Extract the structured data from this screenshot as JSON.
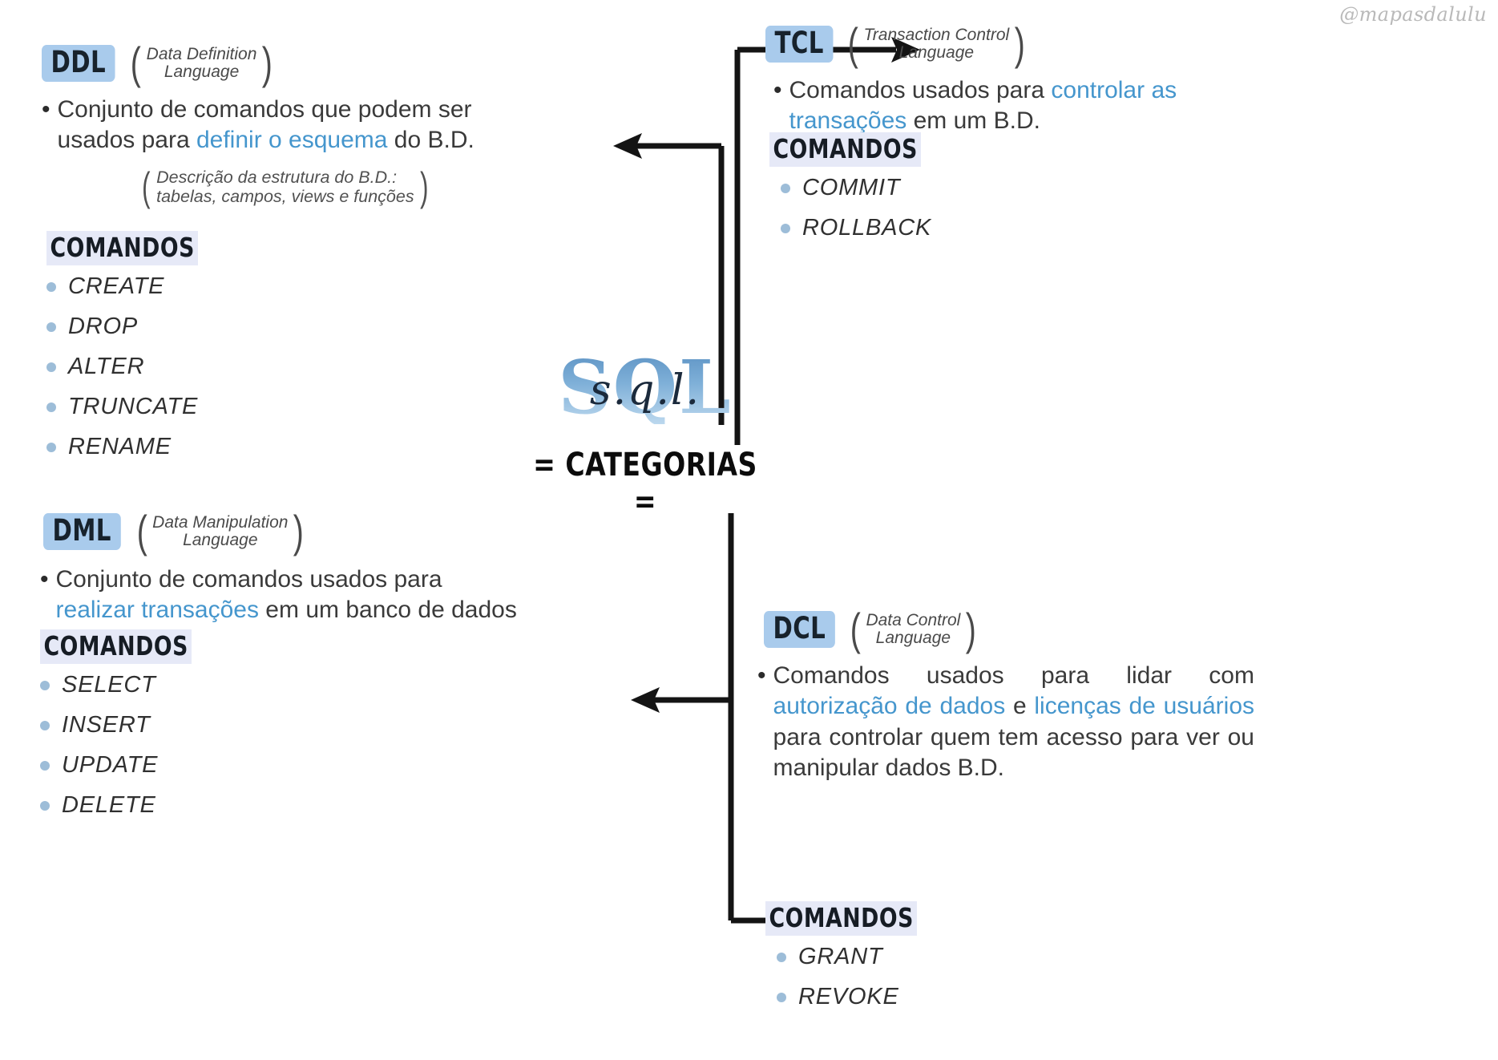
{
  "watermark": "@mapasdalulu",
  "center": {
    "logo_text": "SQL",
    "logo_script": "s.q.l.",
    "subtitle": "= CATEGORIAS ="
  },
  "categories": [
    {
      "id": "ddl",
      "abbr": "DDL",
      "expansion": "Data Definition\nLanguage",
      "description_parts": [
        {
          "text": "Conjunto de comandos que podem ser usados para ",
          "highlight": false
        },
        {
          "text": "definir o esquema",
          "highlight": true
        },
        {
          "text": " do B.D.",
          "highlight": false
        }
      ],
      "description_plain": "Conjunto de comandos que podem ser usados para definir o esquema do B.D.",
      "note": "Descrição da estrutura do B.D.:\ntabelas, campos, views e funções",
      "commands_title": "COMANDOS",
      "commands": [
        "CREATE",
        "DROP",
        "ALTER",
        "TRUNCATE",
        "RENAME"
      ]
    },
    {
      "id": "dml",
      "abbr": "DML",
      "expansion": "Data Manipulation\nLanguage",
      "description_parts": [
        {
          "text": "Conjunto de comandos usados para ",
          "highlight": false
        },
        {
          "text": "realizar transações",
          "highlight": true
        },
        {
          "text": " em um banco de dados",
          "highlight": false
        }
      ],
      "description_plain": "Conjunto de comandos usados para realizar transações em um banco de dados",
      "note": "",
      "commands_title": "COMANDOS",
      "commands": [
        "SELECT",
        "INSERT",
        "UPDATE",
        "DELETE"
      ]
    },
    {
      "id": "tcl",
      "abbr": "TCL",
      "expansion": "Transaction Control\nLanguage",
      "description_parts": [
        {
          "text": "Comandos usados para ",
          "highlight": false
        },
        {
          "text": "controlar as transações",
          "highlight": true
        },
        {
          "text": " em um B.D.",
          "highlight": false
        }
      ],
      "description_plain": "Comandos usados para controlar as transações em um B.D.",
      "note": "",
      "commands_title": "COMANDOS",
      "commands": [
        "COMMIT",
        "ROLLBACK"
      ]
    },
    {
      "id": "dcl",
      "abbr": "DCL",
      "expansion": "Data Control\nLanguage",
      "description_parts": [
        {
          "text": "Comandos usados para lidar com ",
          "highlight": false
        },
        {
          "text": "autorização de dados",
          "highlight": true
        },
        {
          "text": " e ",
          "highlight": false
        },
        {
          "text": "licenças de usuários",
          "highlight": true
        },
        {
          "text": " para controlar quem tem acesso para ver ou manipular dados B.D.",
          "highlight": false
        }
      ],
      "description_plain": "Comandos usados para lidar com autorização de dados e licenças de usuários para controlar quem tem acesso para ver ou manipular dados B.D.",
      "note": "",
      "commands_title": "COMANDOS",
      "commands": [
        "GRANT",
        "REVOKE"
      ]
    }
  ],
  "colors": {
    "badge_blue": "#a9cbec",
    "highlight_blue": "#4596cd",
    "command_title_bg": "#e6e9f7",
    "bullet_blue": "#9dbdd8",
    "connector_black": "#141414"
  }
}
